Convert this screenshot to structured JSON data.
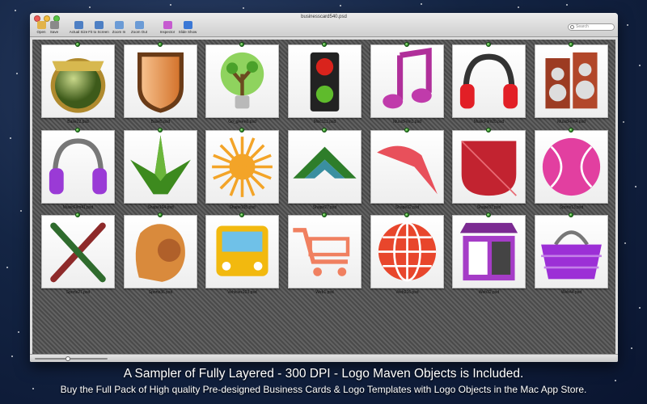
{
  "window": {
    "title": "businesscard540.psd"
  },
  "toolbar": {
    "buttons": [
      {
        "label": "Open",
        "icon": "folder-icon",
        "color": "#e2b34a"
      },
      {
        "label": "Save",
        "icon": "disk-icon",
        "color": "#8a8a8a"
      },
      {
        "label": "Actual Size",
        "icon": "monitor-icon",
        "color": "#4d7fc4"
      },
      {
        "label": "Fit to Screen",
        "icon": "fit-screen-icon",
        "color": "#4d7fc4"
      },
      {
        "label": "Zoom In",
        "icon": "zoom-in-icon",
        "color": "#6b9bd6"
      },
      {
        "label": "Zoom Out",
        "icon": "zoom-out-icon",
        "color": "#6b9bd6"
      },
      {
        "label": "Inspector",
        "icon": "color-wheel-icon",
        "color": "#c65bd0"
      },
      {
        "label": "Slide Show",
        "icon": "play-icon",
        "color": "#3b78d6"
      }
    ],
    "search_placeholder": "Search"
  },
  "files": [
    {
      "name": "Base22.psd",
      "icon": "gold-seal-badge"
    },
    {
      "name": "Base5.psd",
      "icon": "orange-shield"
    },
    {
      "name": "Go_green6.psd",
      "icon": "green-lightbulb"
    },
    {
      "name": "Misc113.psd",
      "icon": "traffic-light"
    },
    {
      "name": "MusicFilm1.psd",
      "icon": "music-note"
    },
    {
      "name": "MusicFilm20.psd",
      "icon": "red-headphones"
    },
    {
      "name": "MusicFilm4.psd",
      "icon": "speakers"
    },
    {
      "name": "MusicFilm41.psd",
      "icon": "purple-headphones"
    },
    {
      "name": "Shape104.psd",
      "icon": "green-crown"
    },
    {
      "name": "Shape105.psd",
      "icon": "orange-sun"
    },
    {
      "name": "Shape27.psd",
      "icon": "green-chevron"
    },
    {
      "name": "Shape32.psd",
      "icon": "red-swoosh"
    },
    {
      "name": "Shape37.psd",
      "icon": "red-leaf"
    },
    {
      "name": "Sports13.psd",
      "icon": "pink-baseball"
    },
    {
      "name": "Sports27.psd",
      "icon": "crossed-bats"
    },
    {
      "name": "Sports36.psd",
      "icon": "baseball-glove"
    },
    {
      "name": "Vehicles103.psd",
      "icon": "yellow-bus"
    },
    {
      "name": "Web1.psd",
      "icon": "shopping-cart"
    },
    {
      "name": "Web216.psd",
      "icon": "red-globe"
    },
    {
      "name": "Web32.psd",
      "icon": "purple-store"
    },
    {
      "name": "Web44.psd",
      "icon": "purple-basket"
    }
  ],
  "zoom_slider": {
    "value": 0.45
  },
  "promo": {
    "line1": "A Sampler of  Fully Layered - 300 DPI - Logo Maven Objects is Included.",
    "line2": "Buy the Full Pack of High quality  Pre-designed Business Cards & Logo Templates with Logo Objects in the Mac App Store."
  }
}
